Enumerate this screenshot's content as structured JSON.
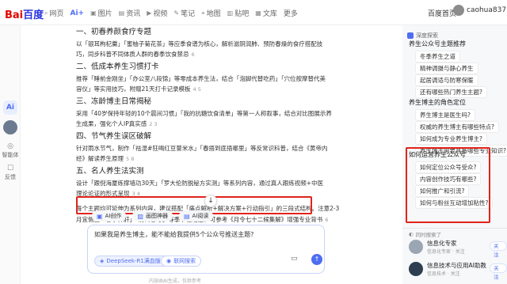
{
  "topbar": {
    "logo_left": "Bai",
    "logo_right": "百度",
    "tabs": [
      {
        "icon": "search-icon",
        "glyph": "⌕",
        "label": "网页"
      },
      {
        "icon": "ai-icon",
        "glyph": "",
        "label": "Ai+"
      },
      {
        "icon": "image-icon",
        "glyph": "▣",
        "label": "图片"
      },
      {
        "icon": "news-icon",
        "glyph": "▤",
        "label": "资讯"
      },
      {
        "icon": "video-icon",
        "glyph": "▶",
        "label": "视频"
      },
      {
        "icon": "note-icon",
        "glyph": "✎",
        "label": "笔记"
      },
      {
        "icon": "map-icon",
        "glyph": "⌖",
        "label": "地图"
      },
      {
        "icon": "library-icon",
        "glyph": "▥",
        "label": "贴吧"
      },
      {
        "icon": "doc-icon",
        "glyph": "▦",
        "label": "文库"
      },
      {
        "icon": "more-icon",
        "glyph": "",
        "label": "更多"
      }
    ],
    "home_link": "百度首页",
    "username": "caohua8371"
  },
  "rail": {
    "ai_label": "Ai",
    "items": [
      {
        "icon": "brain-icon",
        "glyph": "◎",
        "label": "智能体"
      },
      {
        "icon": "feedback-icon",
        "glyph": "☐",
        "label": "反馈"
      }
    ]
  },
  "content": {
    "lines": [
      {
        "kind": "h",
        "text": "一、初春养颜食疗专题"
      },
      {
        "kind": "p",
        "text": "以「银耳枸杞羹」「蜜柚子菊花茶」等应季食谱为核心，解析滋阴润肺、预防春燥的食疗搭配技",
        "refs": ""
      },
      {
        "kind": "p",
        "text": "巧，同步科普不同体质人群的春季饮食禁忌",
        "refs": "6"
      },
      {
        "kind": "h",
        "text": "二、低成本养生习惯打卡"
      },
      {
        "kind": "p",
        "text": "推荐「睡前金刚坐」「办公室八段锦」等零成本养生法，结合「泡脚代替吃药」「穴位按摩替代美",
        "refs": ""
      },
      {
        "kind": "p",
        "text": "容仪」等实用技巧，附赠21天打卡记录模板",
        "refs": "4  5"
      },
      {
        "kind": "h",
        "text": "三、冻龄博主日常揭秘"
      },
      {
        "kind": "p",
        "text": "采用「40岁保持年轻的10个晨间习惯」「我的抗糖饮食清单」等第一人称叙事，结合对比图展示养",
        "refs": ""
      },
      {
        "kind": "p",
        "text": "生成果，强化个人IP真实感",
        "refs": "2  3"
      },
      {
        "kind": "h",
        "text": "四、节气养生误区破解"
      },
      {
        "kind": "p",
        "text": "针对雨水节气，制作「祛湿#狂喝红豆薏米水」「春捂到底捂哪里」等反常识科普，结合《黄帝内",
        "refs": ""
      },
      {
        "kind": "p",
        "text": "经》解读养生原理",
        "refs": "5  8"
      },
      {
        "kind": "h",
        "text": "五、名人养生法实测"
      },
      {
        "kind": "p",
        "text": "设计「跟倪海厦练撑墙功30天」「罗大伦防脱秘方实测」等系列内容，通过真人跟练视频+中医",
        "refs": ""
      },
      {
        "kind": "p",
        "text": "理论论证的形式呈现",
        "refs": "3  4"
      },
      {
        "kind": "p",
        "text": "每个主题均可延伸为系列内容，建议搭配「痛点解析+解决方案+行动指引」的三段式结构。注意2-3",
        "refs": ""
      },
      {
        "kind": "p",
        "text": "月宜侧重「春季养肝」「防倒春寒」等季节性话题，可参考《月令七十二候集解》增强专业背书",
        "refs": "6"
      }
    ],
    "scroll_glyph": "↓"
  },
  "tools": [
    {
      "icon": "doc-gen-icon",
      "glyph": "▣",
      "label": "AI创作"
    },
    {
      "icon": "image-gen-icon",
      "glyph": "▨",
      "label": "画图神器"
    },
    {
      "icon": "ppt-icon",
      "glyph": "▤",
      "label": "AI阅读"
    }
  ],
  "input": {
    "text": "如果我是养生博主，能不能给我提供5个公众号推送主题?",
    "model_chip": "DeepSeek-R1满血版",
    "web_chip": "联网搜索",
    "disclaimer": "内容由AI生成，仅供参考"
  },
  "right_panel": {
    "header": "深度探索",
    "sections": [
      {
        "title": "养生公众号主题推荐",
        "items": [
          "冬季养生之道",
          "精神调摄与静心养生",
          "起居调适与防寒保暖",
          "还有哪些热门养生主题?"
        ]
      },
      {
        "title": "养生博主的角色定位",
        "items": [
          "养生博主是医生吗?",
          "权威的养生博主有哪些特点?",
          "如何成为专业养生博主?",
          "养生博主需要具备哪些专业知识?"
        ]
      },
      {
        "title": "如何运营养生公众号",
        "items": [
          "如何定位公众号受众?",
          "内容创作技巧有哪些?",
          "如何推广和引流?",
          "如何与粉丝互动增加粘性?"
        ]
      }
    ],
    "related_label": "同时搜索了",
    "accounts": [
      {
        "name": "信息化专家",
        "sub": "信息化专家 · 关注",
        "follow": "关注"
      },
      {
        "name": "信息技术与应用AI助教",
        "sub": "信息技术 · 关注",
        "follow": "关注"
      }
    ]
  }
}
